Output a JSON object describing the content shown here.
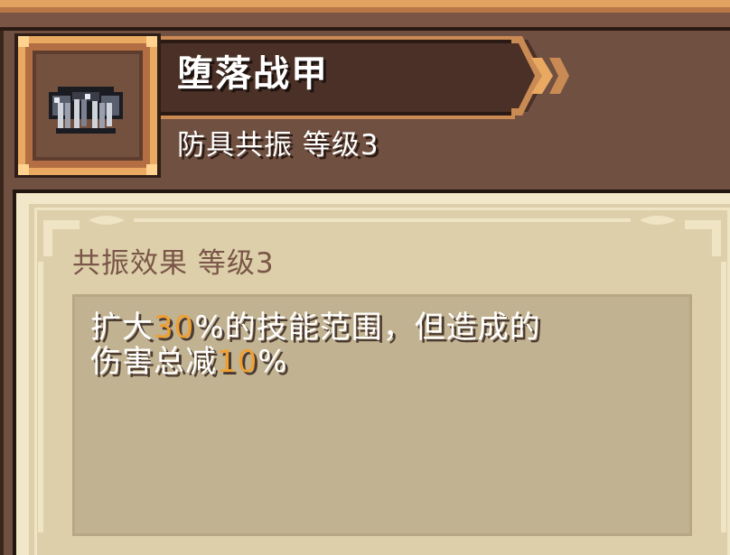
{
  "item": {
    "name": "堕落战甲",
    "subtitle": "防具共振 等级3",
    "icon": "armor-icon"
  },
  "effect": {
    "title": "共振效果 等级3",
    "desc": {
      "line1_a": "扩大",
      "line1_value": "30",
      "line1_b": "%的技能范围，但造成的",
      "line2_a": "伤害总减",
      "line2_value": "10",
      "line2_b": "%"
    }
  },
  "colors": {
    "highlight": "#f0a030",
    "panel_bg": "#705142",
    "card_bg": "#ddcfaa",
    "desc_box": "#c1b291"
  }
}
